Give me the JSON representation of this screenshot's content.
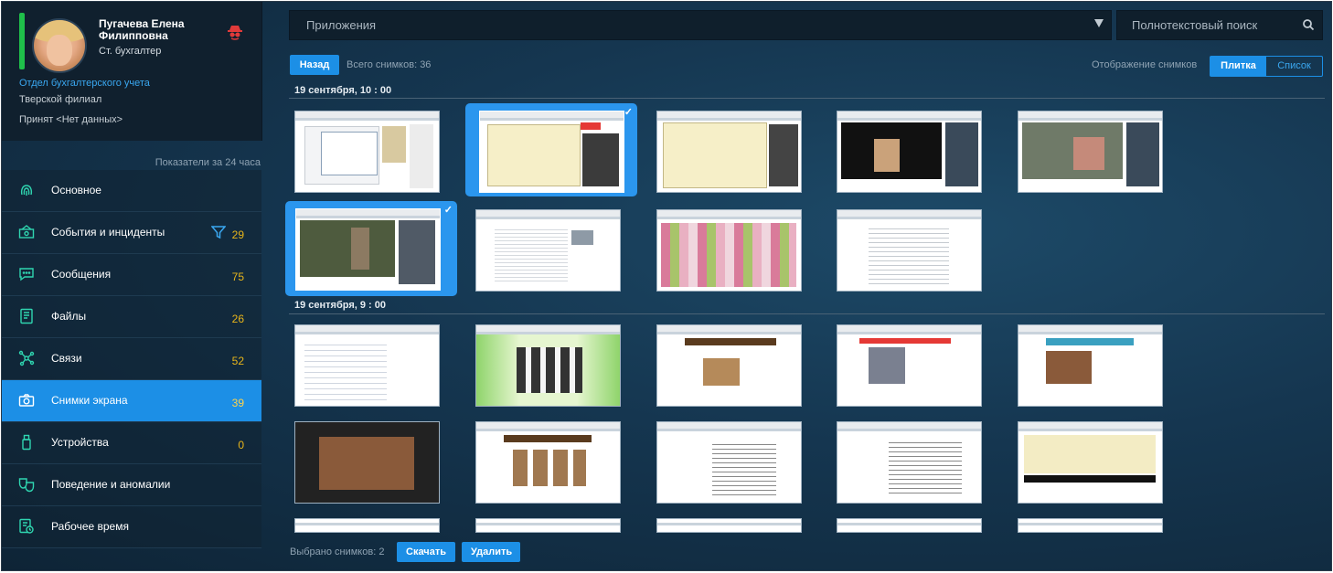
{
  "profile": {
    "name": "Пугачева Елена Филипповна",
    "position": "Ст. бухгалтер",
    "department": "Отдел бухгалтерского учета",
    "branch": "Тверской филиал",
    "hired": "Принят <Нет данных>",
    "activity_level": 1.0
  },
  "metrics_caption": "Показатели за 24 часа",
  "nav": [
    {
      "label": "Основное",
      "count": "",
      "icon": "fingerprint-icon"
    },
    {
      "label": "События и инциденты",
      "count": "29",
      "icon": "events-icon"
    },
    {
      "label": "Сообщения",
      "count": "75",
      "icon": "chat-icon"
    },
    {
      "label": "Файлы",
      "count": "26",
      "icon": "file-icon"
    },
    {
      "label": "Связи",
      "count": "52",
      "icon": "network-icon"
    },
    {
      "label": "Снимки экрана",
      "count": "39",
      "icon": "camera-icon"
    },
    {
      "label": "Устройства",
      "count": "0",
      "icon": "usb-icon"
    },
    {
      "label": "Поведение и аномалии",
      "count": "",
      "icon": "masks-icon"
    },
    {
      "label": "Рабочее время",
      "count": "",
      "icon": "clock-icon"
    }
  ],
  "top": {
    "apps_select": "Приложения",
    "search_placeholder": "Полнотекстовый поиск"
  },
  "toolbar": {
    "back": "Назад",
    "total": "Всего снимков: 36",
    "view_caption": "Отображение снимков",
    "view_tile": "Плитка",
    "view_list": "Список"
  },
  "groups": [
    {
      "title": "19 сентября, 10 : 00"
    },
    {
      "title": "19 сентября, 9 : 00"
    }
  ],
  "footer": {
    "selected": "Выбрано снимков: 2",
    "download": "Скачать",
    "delete": "Удалить"
  },
  "colors": {
    "accent": "#1c8fe6",
    "count": "#e8b51a",
    "link": "#3aa7f0"
  }
}
